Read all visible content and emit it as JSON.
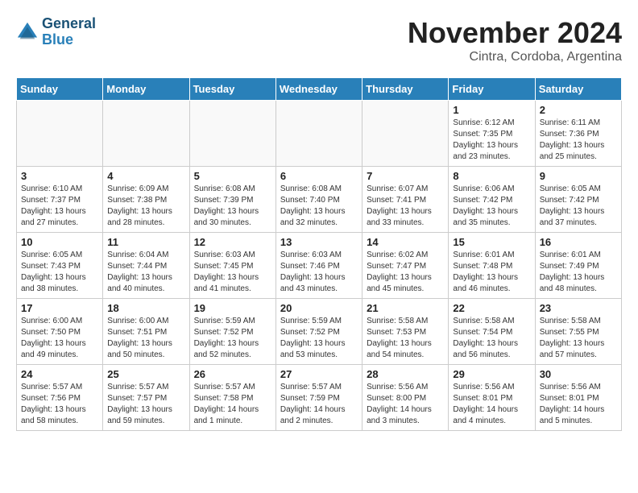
{
  "header": {
    "logo_line1": "General",
    "logo_line2": "Blue",
    "month_title": "November 2024",
    "location": "Cintra, Cordoba, Argentina"
  },
  "weekdays": [
    "Sunday",
    "Monday",
    "Tuesday",
    "Wednesday",
    "Thursday",
    "Friday",
    "Saturday"
  ],
  "weeks": [
    [
      {
        "day": "",
        "info": ""
      },
      {
        "day": "",
        "info": ""
      },
      {
        "day": "",
        "info": ""
      },
      {
        "day": "",
        "info": ""
      },
      {
        "day": "",
        "info": ""
      },
      {
        "day": "1",
        "info": "Sunrise: 6:12 AM\nSunset: 7:35 PM\nDaylight: 13 hours\nand 23 minutes."
      },
      {
        "day": "2",
        "info": "Sunrise: 6:11 AM\nSunset: 7:36 PM\nDaylight: 13 hours\nand 25 minutes."
      }
    ],
    [
      {
        "day": "3",
        "info": "Sunrise: 6:10 AM\nSunset: 7:37 PM\nDaylight: 13 hours\nand 27 minutes."
      },
      {
        "day": "4",
        "info": "Sunrise: 6:09 AM\nSunset: 7:38 PM\nDaylight: 13 hours\nand 28 minutes."
      },
      {
        "day": "5",
        "info": "Sunrise: 6:08 AM\nSunset: 7:39 PM\nDaylight: 13 hours\nand 30 minutes."
      },
      {
        "day": "6",
        "info": "Sunrise: 6:08 AM\nSunset: 7:40 PM\nDaylight: 13 hours\nand 32 minutes."
      },
      {
        "day": "7",
        "info": "Sunrise: 6:07 AM\nSunset: 7:41 PM\nDaylight: 13 hours\nand 33 minutes."
      },
      {
        "day": "8",
        "info": "Sunrise: 6:06 AM\nSunset: 7:42 PM\nDaylight: 13 hours\nand 35 minutes."
      },
      {
        "day": "9",
        "info": "Sunrise: 6:05 AM\nSunset: 7:42 PM\nDaylight: 13 hours\nand 37 minutes."
      }
    ],
    [
      {
        "day": "10",
        "info": "Sunrise: 6:05 AM\nSunset: 7:43 PM\nDaylight: 13 hours\nand 38 minutes."
      },
      {
        "day": "11",
        "info": "Sunrise: 6:04 AM\nSunset: 7:44 PM\nDaylight: 13 hours\nand 40 minutes."
      },
      {
        "day": "12",
        "info": "Sunrise: 6:03 AM\nSunset: 7:45 PM\nDaylight: 13 hours\nand 41 minutes."
      },
      {
        "day": "13",
        "info": "Sunrise: 6:03 AM\nSunset: 7:46 PM\nDaylight: 13 hours\nand 43 minutes."
      },
      {
        "day": "14",
        "info": "Sunrise: 6:02 AM\nSunset: 7:47 PM\nDaylight: 13 hours\nand 45 minutes."
      },
      {
        "day": "15",
        "info": "Sunrise: 6:01 AM\nSunset: 7:48 PM\nDaylight: 13 hours\nand 46 minutes."
      },
      {
        "day": "16",
        "info": "Sunrise: 6:01 AM\nSunset: 7:49 PM\nDaylight: 13 hours\nand 48 minutes."
      }
    ],
    [
      {
        "day": "17",
        "info": "Sunrise: 6:00 AM\nSunset: 7:50 PM\nDaylight: 13 hours\nand 49 minutes."
      },
      {
        "day": "18",
        "info": "Sunrise: 6:00 AM\nSunset: 7:51 PM\nDaylight: 13 hours\nand 50 minutes."
      },
      {
        "day": "19",
        "info": "Sunrise: 5:59 AM\nSunset: 7:52 PM\nDaylight: 13 hours\nand 52 minutes."
      },
      {
        "day": "20",
        "info": "Sunrise: 5:59 AM\nSunset: 7:52 PM\nDaylight: 13 hours\nand 53 minutes."
      },
      {
        "day": "21",
        "info": "Sunrise: 5:58 AM\nSunset: 7:53 PM\nDaylight: 13 hours\nand 54 minutes."
      },
      {
        "day": "22",
        "info": "Sunrise: 5:58 AM\nSunset: 7:54 PM\nDaylight: 13 hours\nand 56 minutes."
      },
      {
        "day": "23",
        "info": "Sunrise: 5:58 AM\nSunset: 7:55 PM\nDaylight: 13 hours\nand 57 minutes."
      }
    ],
    [
      {
        "day": "24",
        "info": "Sunrise: 5:57 AM\nSunset: 7:56 PM\nDaylight: 13 hours\nand 58 minutes."
      },
      {
        "day": "25",
        "info": "Sunrise: 5:57 AM\nSunset: 7:57 PM\nDaylight: 13 hours\nand 59 minutes."
      },
      {
        "day": "26",
        "info": "Sunrise: 5:57 AM\nSunset: 7:58 PM\nDaylight: 14 hours\nand 1 minute."
      },
      {
        "day": "27",
        "info": "Sunrise: 5:57 AM\nSunset: 7:59 PM\nDaylight: 14 hours\nand 2 minutes."
      },
      {
        "day": "28",
        "info": "Sunrise: 5:56 AM\nSunset: 8:00 PM\nDaylight: 14 hours\nand 3 minutes."
      },
      {
        "day": "29",
        "info": "Sunrise: 5:56 AM\nSunset: 8:01 PM\nDaylight: 14 hours\nand 4 minutes."
      },
      {
        "day": "30",
        "info": "Sunrise: 5:56 AM\nSunset: 8:01 PM\nDaylight: 14 hours\nand 5 minutes."
      }
    ]
  ]
}
